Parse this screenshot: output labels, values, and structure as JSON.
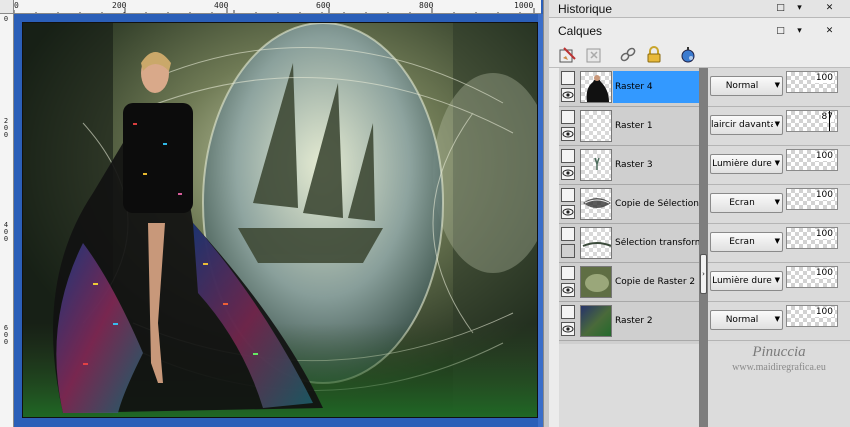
{
  "ruler": {
    "top_labels": [
      "0",
      "200",
      "400",
      "600",
      "800",
      "1000"
    ],
    "left_labels": [
      "0",
      "200",
      "400",
      "600"
    ]
  },
  "historique": {
    "title": "Historique",
    "buttons": [
      "pin-icon",
      "menu-arrow-icon",
      "close-icon"
    ]
  },
  "calques": {
    "title": "Calques",
    "buttons": [
      "maximize-icon",
      "menu-arrow-icon",
      "close-icon"
    ],
    "toolbar": [
      "new-raster-layer-icon",
      "new-vector-layer-icon",
      "link-icon",
      "lock-icon",
      "palette-icon"
    ],
    "layers": [
      {
        "name": "Raster 4",
        "blend": "Normal",
        "opacity": "100",
        "selected": true
      },
      {
        "name": "Raster 1",
        "blend": "laircir davantage",
        "opacity": "87",
        "selected": false
      },
      {
        "name": "Raster 3",
        "blend": "Lumière dure",
        "opacity": "100",
        "selected": false
      },
      {
        "name": "Copie de Sélection tr",
        "blend": "Écran",
        "opacity": "100",
        "selected": false
      },
      {
        "name": "Sélection transformée",
        "blend": "Écran",
        "opacity": "100",
        "selected": false
      },
      {
        "name": "Copie de Raster 2",
        "blend": "Lumière dure",
        "opacity": "100",
        "selected": false
      },
      {
        "name": "Raster 2",
        "blend": "Normal",
        "opacity": "100",
        "selected": false
      }
    ]
  },
  "watermark": {
    "name": "Pinuccia",
    "url": "www.maidiregrafica.eu"
  },
  "colors": {
    "selection": "#3399ff",
    "window_blue": "#1f4fa3"
  }
}
